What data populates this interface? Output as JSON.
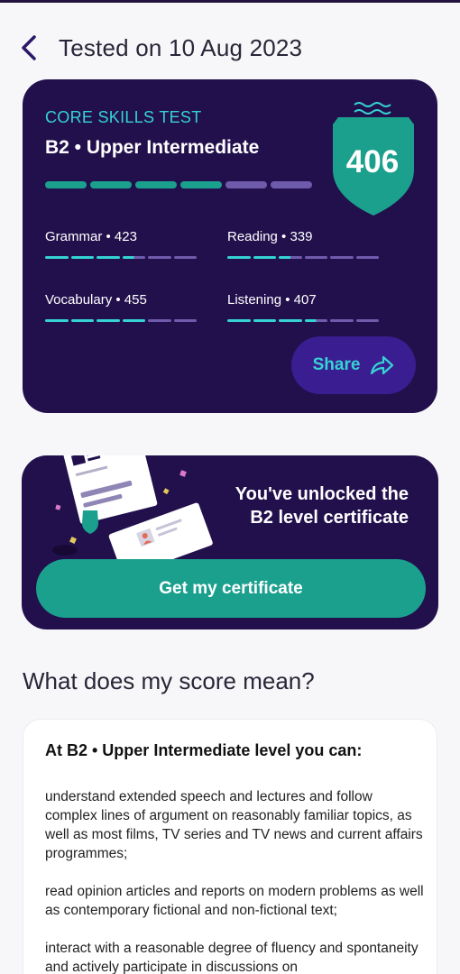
{
  "header": {
    "title": "Tested on 10 Aug 2023"
  },
  "score_card": {
    "test_name": "CORE SKILLS TEST",
    "level": "B2 • Upper Intermediate",
    "score": "406",
    "main_progress": {
      "filled_segments": 4,
      "total_segments": 6
    },
    "skills": [
      {
        "label": "Grammar • 423",
        "filled": 3.5,
        "total": 6
      },
      {
        "label": "Reading • 339",
        "filled": 2.5,
        "total": 6
      },
      {
        "label": "Vocabulary • 455",
        "filled": 4,
        "total": 6
      },
      {
        "label": "Listening • 407",
        "filled": 3.5,
        "total": 6
      }
    ],
    "share_label": "Share"
  },
  "certificate": {
    "line1": "You've unlocked the",
    "line2": "B2 level certificate",
    "button_label": "Get my certificate"
  },
  "meaning": {
    "title": "What does my score mean?",
    "heading": "At B2 • Upper Intermediate level you can:",
    "items": [
      "understand extended speech and lectures and follow complex lines of argument on reasonably familiar topics, as well as most films, TV series and TV news and current affairs programmes;",
      "read opinion articles and reports on modern problems as well as contemporary fictional and non-fictional text;",
      "interact with a reasonable degree of fluency and spontaneity and actively participate in discussions on"
    ]
  },
  "colors": {
    "card_bg": "#22104d",
    "teal": "#1ba08e",
    "cyan": "#35d3d2",
    "bar_empty": "#6f5bab",
    "share_bg": "#3a1d91"
  }
}
